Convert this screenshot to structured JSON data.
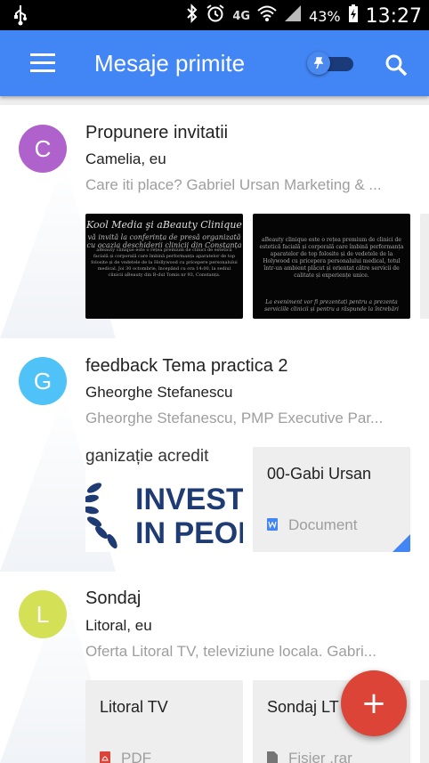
{
  "status_bar": {
    "usb_icon": "usb-icon",
    "network": "4G",
    "battery": "43%",
    "time": "13:27"
  },
  "app_bar": {
    "title": "Mesaje primite",
    "menu_icon": "hamburger-menu-icon",
    "pin_icon": "pin-icon",
    "search_icon": "search-icon",
    "color": "#4285f4"
  },
  "threads": [
    {
      "avatar_letter": "C",
      "avatar_color": "#b062cc",
      "subject": "Propunere invitatii",
      "senders": "Camelia, eu",
      "snippet": "Care iti place? Gabriel Ursan Marketing & ...",
      "previews": [
        {
          "title": "Kool Media şi aBeauty Clinique",
          "subtitle": "vă invită la conferința de presă organizată cu ocazia deschiderii clinicii din Constanța",
          "text": "aBeauty clinique este o rețea premium de clinici de estetică facială și corporală care îmbină performanța aparatelor de top folosite și de vedetele de la Hollywood cu pricepere personalului medical. Joi 30 octombrie, începând cu ora 14:00, la sediul clinicii aBeauty din B-dul Tomis nr 93, Constanța."
        },
        {
          "text": "aBeauty clinique este o rețea premium de clinici de estetică facială și corporală care îmbină performanța aparatelor de top folosite și de vedetele de la Holywood cu pricepera personalului medical, totul într-un ambient plăcut și orientat către servicii de calitate și experiențe unice.",
          "text2": "La eveniment vor fi prezentați pentru a prezenta serviciile clinicii și pentru a răspunde la întrebări"
        }
      ]
    },
    {
      "avatar_letter": "G",
      "avatar_color": "#4fc3f7",
      "subject": "feedback Tema practica 2",
      "senders": "Gheorghe Stefanescu",
      "snippet": "Gheorghe Stefanescu, PMP Executive Par...",
      "image_preview": {
        "line1": "ganizație acredit",
        "line2": "INVESTO",
        "line3": "IN PEOP"
      },
      "attachment": {
        "name": "00-Gabi Ursan",
        "type": "Document",
        "icon": "word-document-icon",
        "icon_color": "#4285f4"
      }
    },
    {
      "avatar_letter": "L",
      "avatar_color": "#d4e157",
      "subject": "Sondaj",
      "senders": "Litoral, eu",
      "snippet": "Oferta Litoral TV, televiziune locala. Gabri...",
      "attachments": [
        {
          "name": "Litoral TV",
          "type": "PDF",
          "icon": "pdf-icon",
          "icon_color": "#db4437"
        },
        {
          "name": "Sondaj LT",
          "type": "Fisier .rar",
          "icon": "file-icon",
          "icon_color": "#757575"
        }
      ]
    }
  ],
  "fab": {
    "label": "+",
    "color": "#db4437",
    "icon": "compose-plus-icon"
  }
}
